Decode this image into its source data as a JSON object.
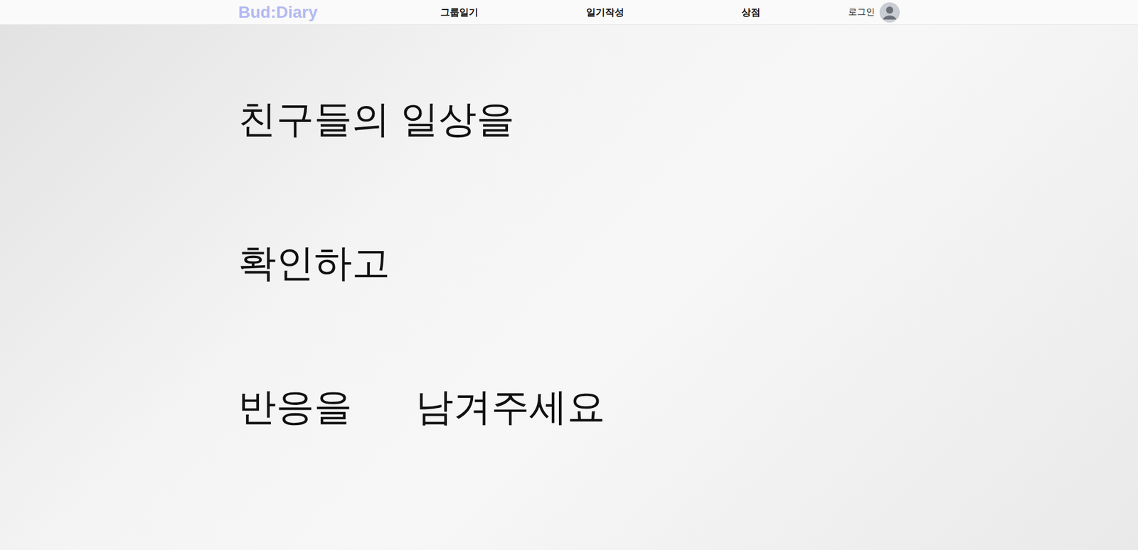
{
  "logo": {
    "text": "Bud:Diary"
  },
  "nav": {
    "items": [
      {
        "label": "그룹일기",
        "selected": false
      },
      {
        "label": "일기작성",
        "selected": false
      },
      {
        "label": "상점",
        "selected": false
      }
    ],
    "login": {
      "label": "로그인"
    }
  },
  "hero": {
    "lines": [
      "친구들의 일상을",
      "확인하고",
      "반응을      남겨주세요"
    ]
  }
}
